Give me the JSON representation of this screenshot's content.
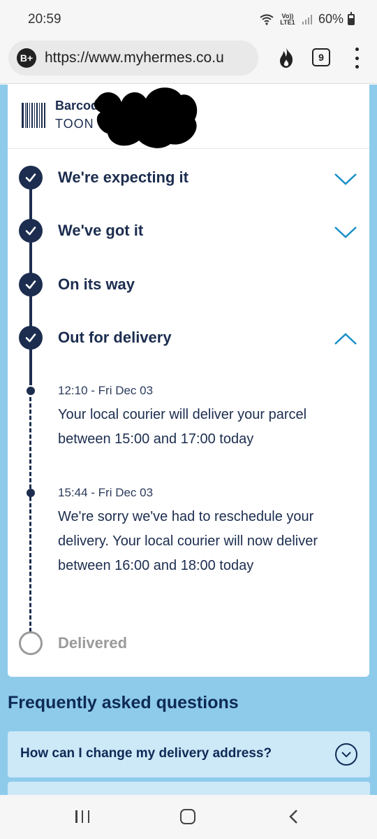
{
  "status_bar": {
    "time": "20:59",
    "network": "Vo)) LTE1",
    "battery": "60%"
  },
  "browser": {
    "badge": "B+",
    "url": "https://www.myhermes.co.u",
    "tab_count": "9"
  },
  "tracking": {
    "barcode_label": "Barcode No:",
    "barcode_value": "TOON",
    "steps": [
      {
        "title": "We're expecting it",
        "done": true,
        "expanded": false
      },
      {
        "title": "We've got it",
        "done": true,
        "expanded": false
      },
      {
        "title": "On its way",
        "done": true
      },
      {
        "title": "Out for delivery",
        "done": true,
        "expanded": true
      },
      {
        "title": "Delivered",
        "done": false
      }
    ],
    "events": [
      {
        "time": "12:10 - Fri Dec 03",
        "text": "Your local courier will deliver your parcel between 15:00 and 17:00 today"
      },
      {
        "time": "15:44 - Fri Dec 03",
        "text": "We're sorry we've had to reschedule your delivery. Your local courier will now deliver between 16:00 and 18:00 today"
      }
    ]
  },
  "faq": {
    "title": "Frequently asked questions",
    "items": [
      {
        "question": "How can I change my delivery address?"
      }
    ]
  },
  "colors": {
    "navy": "#1c2d4f",
    "accent_chevron": "#1a8fc7",
    "page_bg": "#8ecbeb",
    "faq_item_bg": "#cde8f7"
  }
}
